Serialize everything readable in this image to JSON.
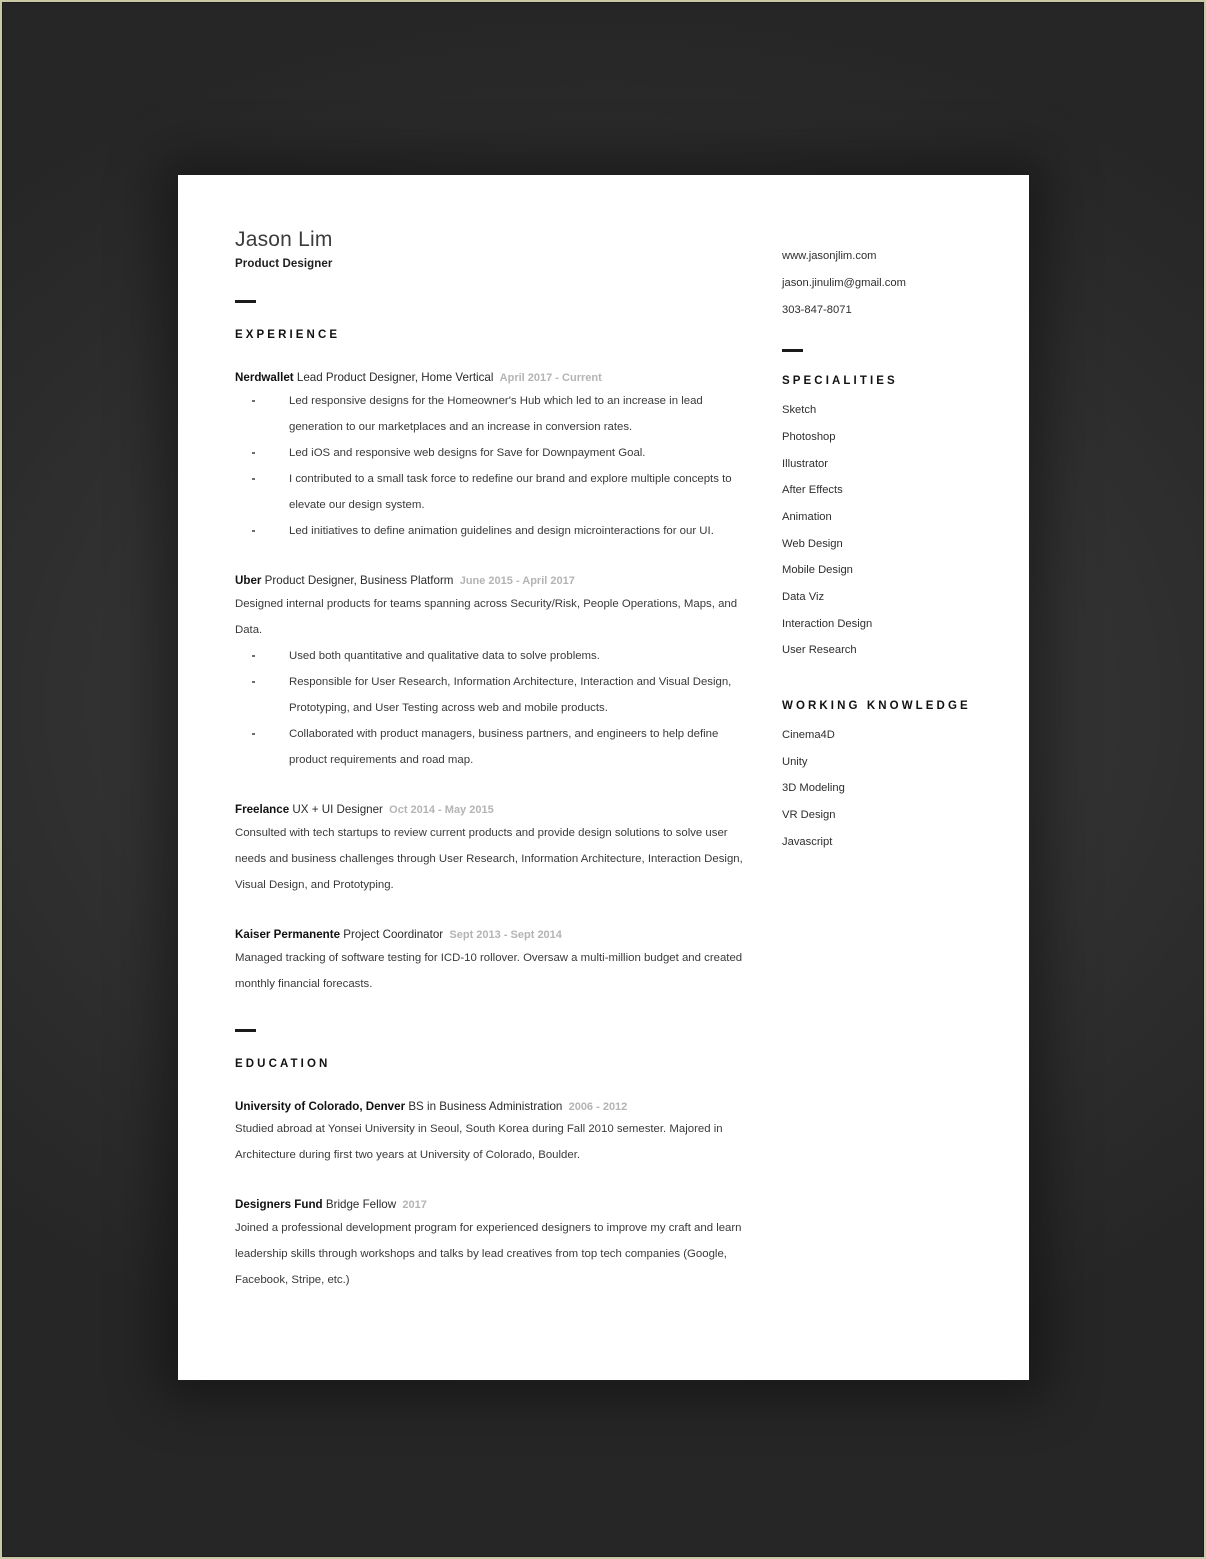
{
  "header": {
    "name": "Jason Lim",
    "role": "Product Designer"
  },
  "contact": {
    "website": "www.jasonjlim.com",
    "email": "jason.jinulim@gmail.com",
    "phone": "303-847-8071"
  },
  "sections": {
    "experience_heading": "EXPERIENCE",
    "education_heading": "EDUCATION",
    "specialities_heading": "SPECIALITIES",
    "working_knowledge_heading": "WORKING  KNOWLEDGE"
  },
  "experience": [
    {
      "org": "Nerdwallet",
      "title": "Lead Product Designer, Home Vertical",
      "dates": "April 2017 - Current",
      "desc": "",
      "bullets": [
        "Led responsive designs for the Homeowner's Hub which led to an increase in lead generation to our marketplaces and an increase in conversion rates.",
        "Led iOS and responsive web designs for Save for Downpayment Goal.",
        "I contributed to a small task force to redefine our brand and explore multiple concepts to elevate our design system.",
        "Led initiatives to define animation guidelines and design microinteractions for our UI."
      ]
    },
    {
      "org": "Uber",
      "title": "Product Designer, Business Platform",
      "dates": "June 2015 - April 2017",
      "desc": "Designed internal products for teams spanning across Security/Risk, People Operations, Maps, and Data.",
      "bullets": [
        "Used both quantitative and qualitative data to solve problems.",
        "Responsible for User Research, Information Architecture, Interaction and Visual Design, Prototyping, and User Testing across web and mobile products.",
        "Collaborated with product managers, business partners, and engineers to help define product requirements and road map."
      ]
    },
    {
      "org": "Freelance",
      "title": "UX + UI Designer",
      "dates": "Oct 2014 - May 2015",
      "desc": "Consulted with tech startups to review current products and provide design solutions to solve user needs and business challenges through User Research, Information Architecture, Interaction Design, Visual Design, and Prototyping.",
      "bullets": []
    },
    {
      "org": "Kaiser Permanente",
      "title": "Project Coordinator",
      "dates": "Sept 2013  - Sept 2014",
      "desc": "Managed tracking of software testing for ICD-10 rollover. Oversaw a multi-million budget and created monthly financial forecasts.",
      "bullets": []
    }
  ],
  "education": [
    {
      "org": "University of Colorado, Denver",
      "title": "BS in Business Administration",
      "dates": "2006 - 2012",
      "desc": "Studied abroad at Yonsei University in Seoul, South Korea during Fall 2010 semester. Majored in Architecture during first two years at University of Colorado, Boulder."
    },
    {
      "org": "Designers Fund",
      "title": "Bridge Fellow",
      "dates": "2017",
      "desc": "Joined a professional development program for experienced designers to improve my craft and learn leadership skills through workshops and talks by lead creatives from top tech companies (Google, Facebook, Stripe, etc.)"
    }
  ],
  "specialities": [
    "Sketch",
    "Photoshop",
    "Illustrator",
    "After Effects",
    "Animation",
    "Web Design",
    "Mobile Design",
    "Data Viz",
    "Interaction Design",
    "User Research"
  ],
  "working_knowledge": [
    "Cinema4D",
    "Unity",
    "3D Modeling",
    "VR Design",
    "Javascript"
  ],
  "colors": {
    "backdrop": "#333333",
    "page": "#ffffff",
    "frame_border": "#c9c9a6",
    "text": "#3a3a3a",
    "heading": "#121212",
    "date_gray": "#b4b4b4"
  }
}
